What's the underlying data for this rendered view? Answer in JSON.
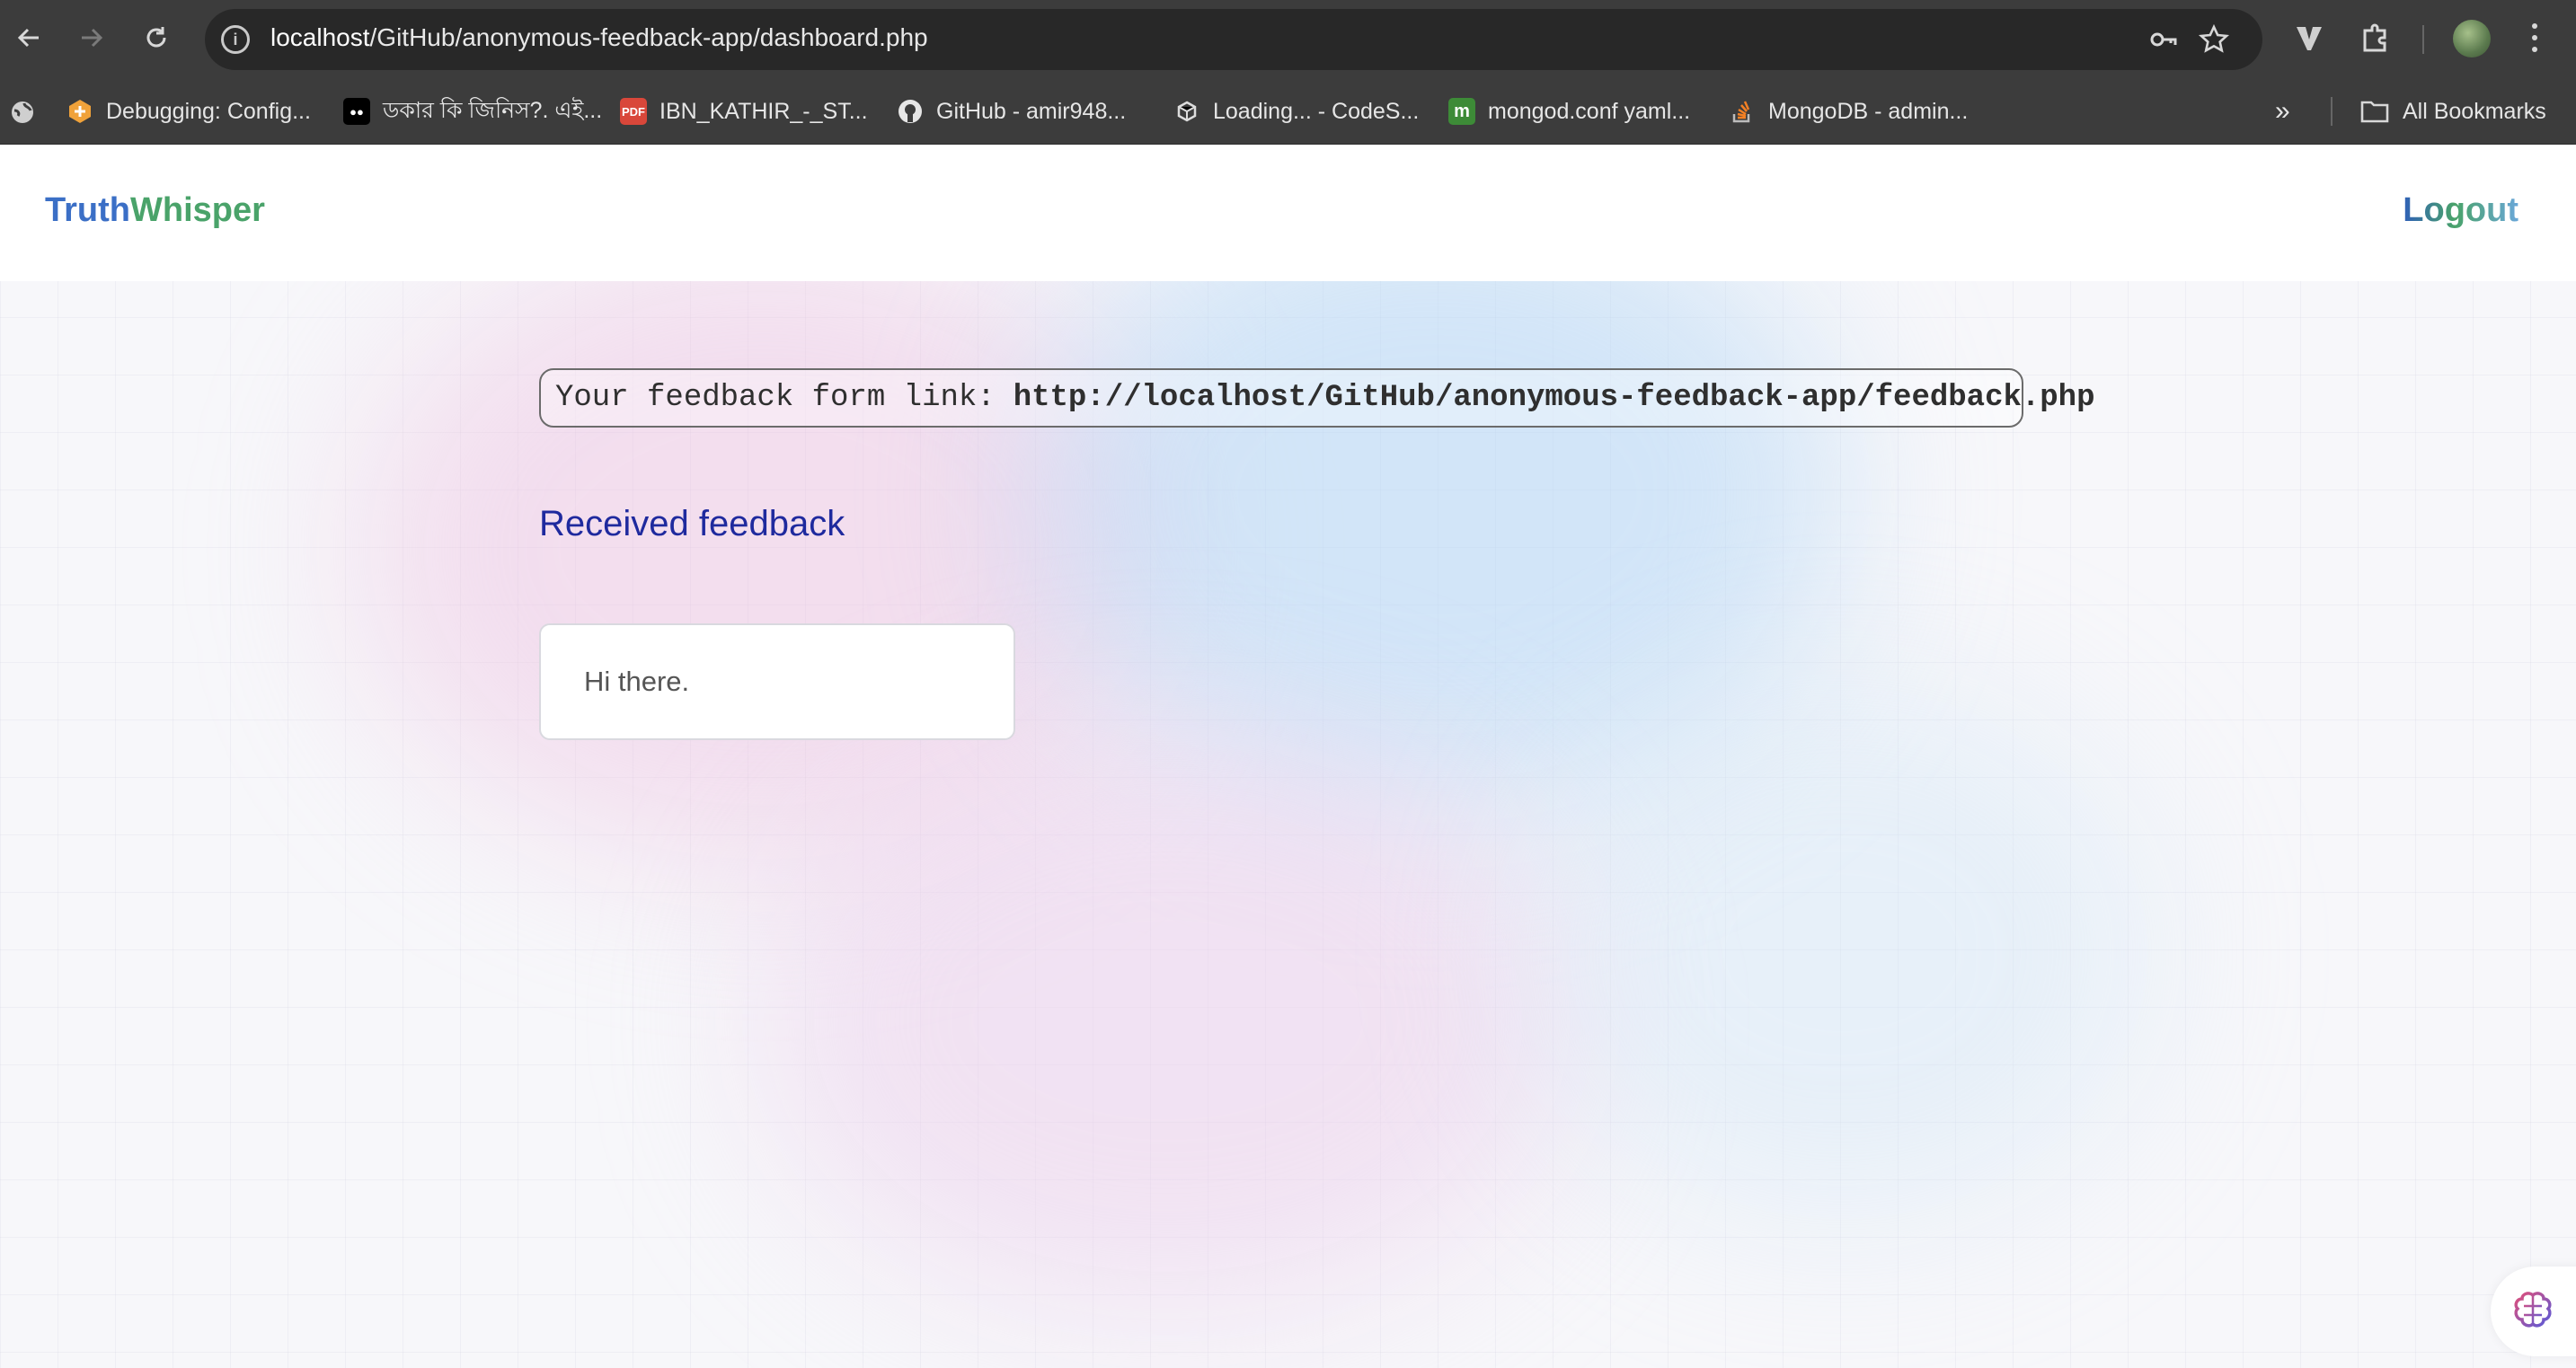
{
  "browser": {
    "url_host": "localhost",
    "url_path": "/GitHub/anonymous-feedback-app/dashboard.php",
    "bookmarks": [
      {
        "label": "Debugging: Config...",
        "icon": "hexagon-icon",
        "color": "#f0a23a"
      },
      {
        "label": "ডকার কি জিনিস?. এই...",
        "icon": "medium-icon",
        "color": "#000000"
      },
      {
        "label": "IBN_KATHIR_-_ST...",
        "icon": "pdf-icon",
        "color": "#d9473a"
      },
      {
        "label": "GitHub - amir948...",
        "icon": "github-icon",
        "color": "#2a2a2a"
      },
      {
        "label": "Loading... - CodeS...",
        "icon": "codesandbox-icon",
        "color": "#dddddd"
      },
      {
        "label": "mongod.conf yaml...",
        "icon": "m-icon",
        "color": "#3d8b37"
      },
      {
        "label": "MongoDB - admin...",
        "icon": "stackoverflow-icon",
        "color": "#f48024"
      }
    ],
    "all_bookmarks_label": "All Bookmarks"
  },
  "navbar": {
    "brand_part1": "Truth",
    "brand_part2": "Whisper",
    "logout_label": "Logout"
  },
  "main": {
    "link_label": "Your feedback form link:",
    "link_url": "http://localhost/GitHub/anonymous-feedback-app/feedback.php",
    "section_title": "Received feedback",
    "feedback": [
      {
        "text": "Hi there."
      }
    ]
  },
  "colors": {
    "brand_blue": "#3b6fc6",
    "brand_green": "#4aa36a",
    "section_title": "#1f2a9e"
  }
}
